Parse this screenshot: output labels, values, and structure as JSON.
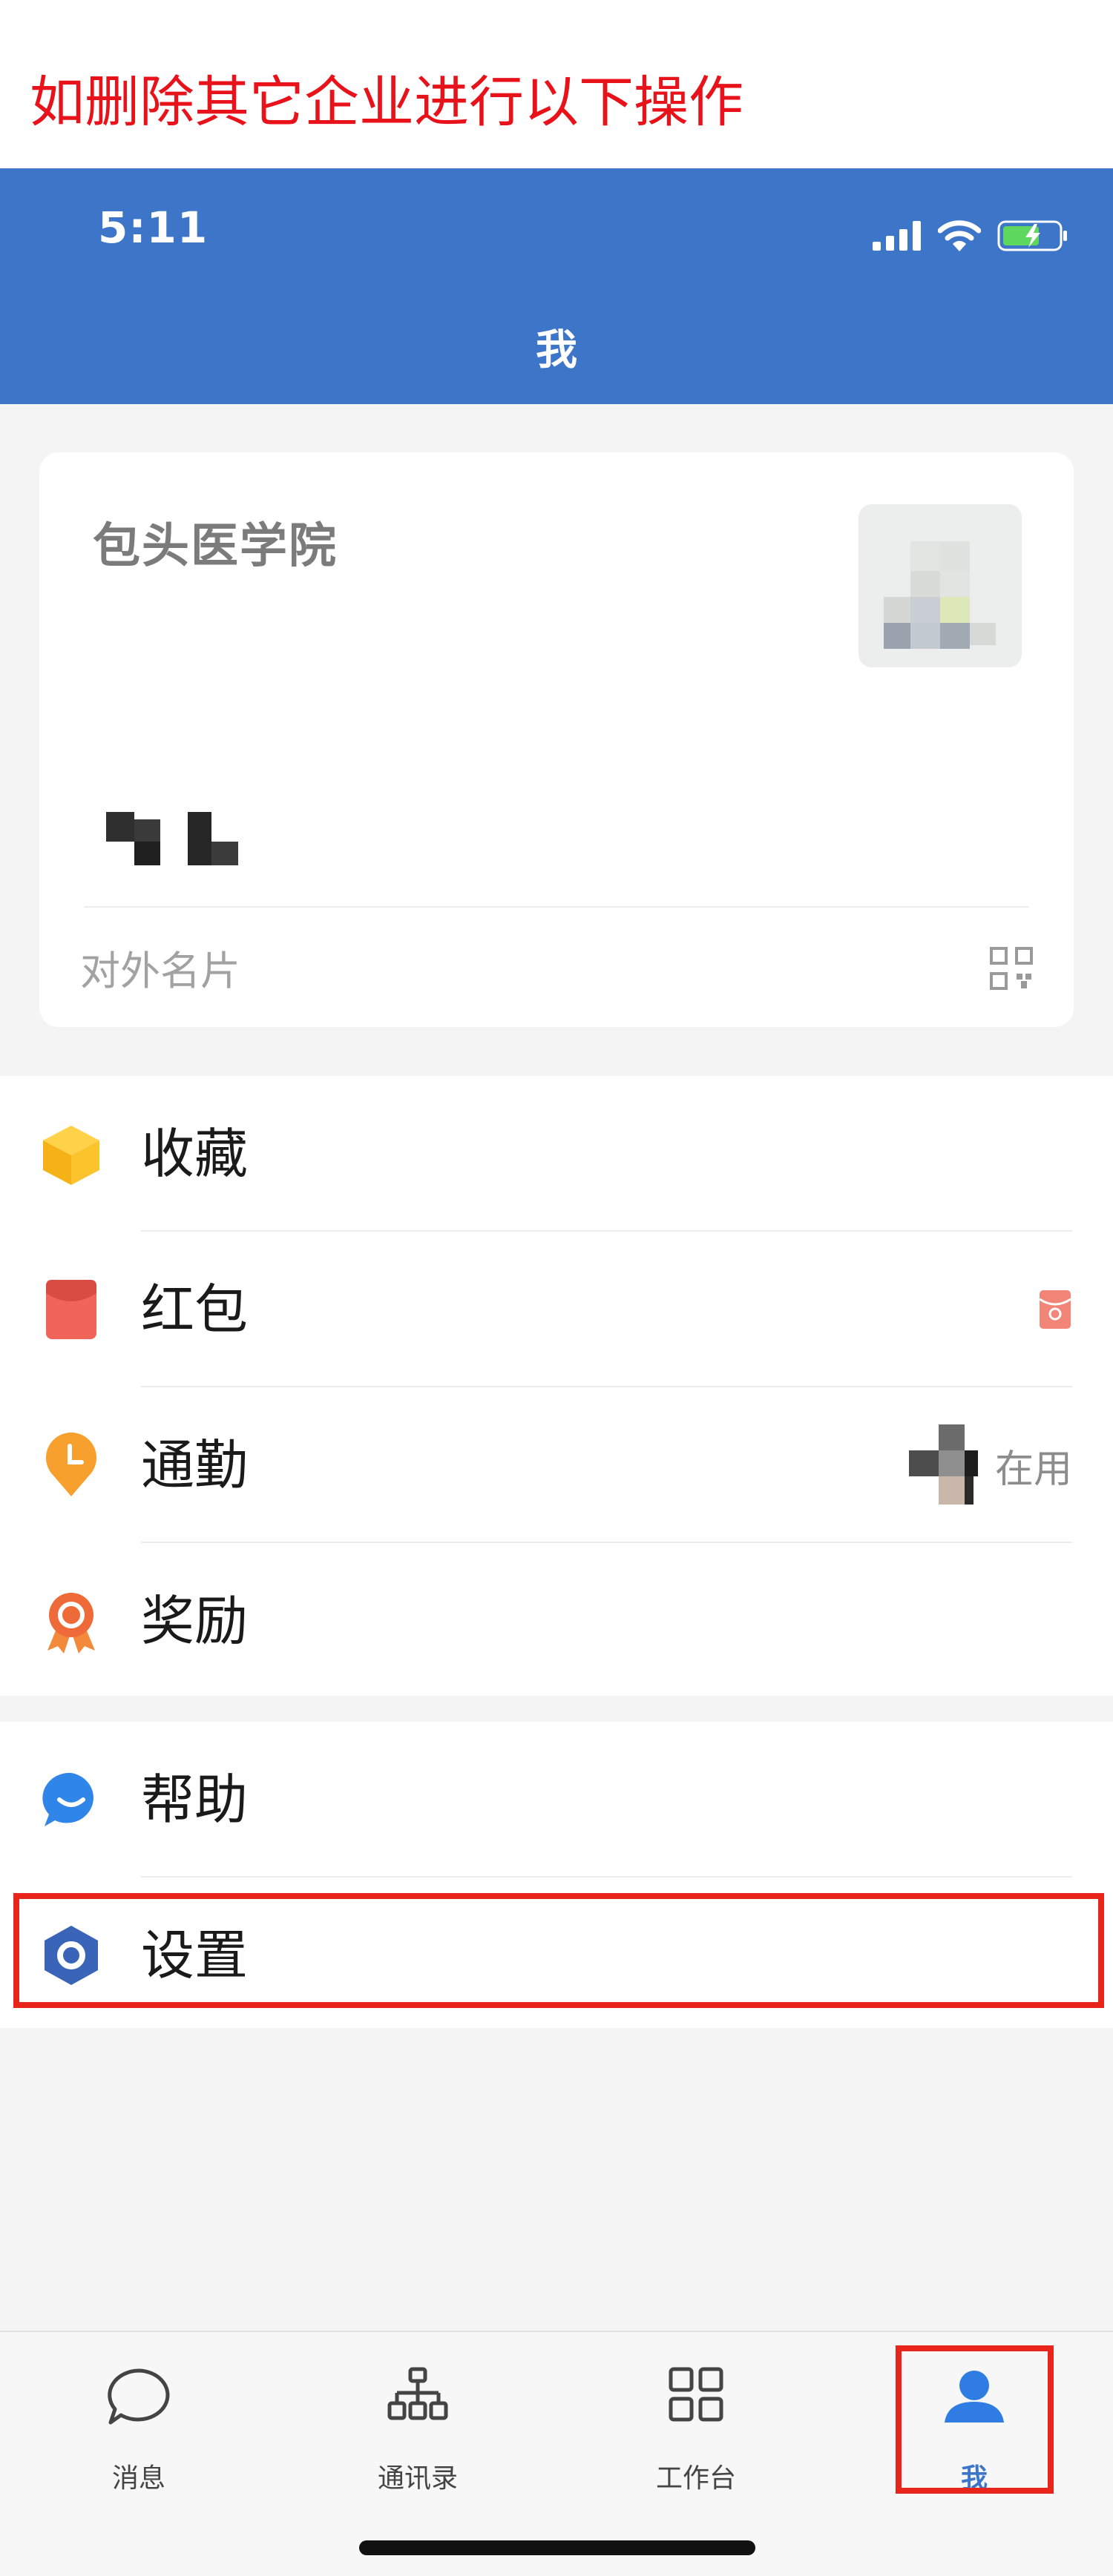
{
  "instruction": {
    "text": "如删除其它企业进行以下操作"
  },
  "status_bar": {
    "time": "5:11",
    "icons": [
      "signal-icon",
      "wifi-icon",
      "battery-charging-icon"
    ]
  },
  "header": {
    "title": "我"
  },
  "profile_card": {
    "org_name": "包头医学院",
    "external_card_label": "对外名片",
    "icons": [
      "avatar",
      "qr-code-icon"
    ]
  },
  "menu": {
    "group1": [
      {
        "label": "收藏",
        "icon": "favorites-cube-icon"
      },
      {
        "label": "红包",
        "icon": "red-envelope-icon"
      },
      {
        "label": "通勤",
        "icon": "commute-clock-pin-icon",
        "status": "在用"
      },
      {
        "label": "奖励",
        "icon": "award-medal-icon"
      }
    ],
    "group2": [
      {
        "label": "帮助",
        "icon": "help-chat-icon"
      },
      {
        "label": "设置",
        "icon": "settings-hexagon-icon"
      }
    ]
  },
  "tabbar": {
    "tabs": [
      {
        "label": "消息",
        "icon": "chat-bubble-icon",
        "active": false
      },
      {
        "label": "通讯录",
        "icon": "org-chart-icon",
        "active": false
      },
      {
        "label": "工作台",
        "icon": "grid-icon",
        "active": false
      },
      {
        "label": "我",
        "icon": "person-icon",
        "active": true
      }
    ]
  },
  "colors": {
    "header_blue": "#3d75c8",
    "highlight_red": "#e8241b",
    "instruction_red": "#e8121b",
    "background": "#f4f4f4"
  }
}
